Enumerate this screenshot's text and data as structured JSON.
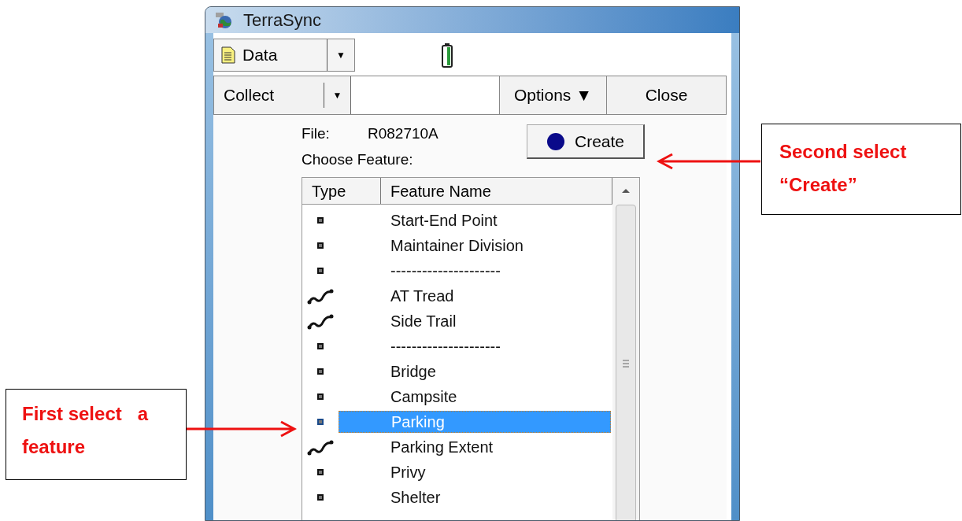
{
  "window": {
    "title": "TerraSync"
  },
  "toolbar": {
    "data_button": "Data",
    "dropdown_arrow": "▼"
  },
  "section_bar": {
    "collect_button": "Collect",
    "collect_arrow": "▼",
    "options_button": "Options ▼",
    "close_button": "Close"
  },
  "file": {
    "label": "File:",
    "value": "R082710A"
  },
  "choose_label": "Choose Feature:",
  "create_button": "Create",
  "table": {
    "columns": [
      "Type",
      "Feature Name"
    ],
    "rows": [
      {
        "kind": "point",
        "name": "Start-End Point",
        "selected": false
      },
      {
        "kind": "point",
        "name": "Maintainer Division",
        "selected": false
      },
      {
        "kind": "point",
        "name": "---------------------",
        "selected": false
      },
      {
        "kind": "line",
        "name": "AT Tread",
        "selected": false
      },
      {
        "kind": "line",
        "name": "Side Trail",
        "selected": false
      },
      {
        "kind": "point",
        "name": "---------------------",
        "selected": false
      },
      {
        "kind": "point",
        "name": "Bridge",
        "selected": false
      },
      {
        "kind": "point",
        "name": "Campsite",
        "selected": false
      },
      {
        "kind": "point",
        "name": "Parking",
        "selected": true
      },
      {
        "kind": "line",
        "name": "Parking Extent",
        "selected": false
      },
      {
        "kind": "point",
        "name": "Privy",
        "selected": false
      },
      {
        "kind": "point",
        "name": "Shelter",
        "selected": false
      }
    ]
  },
  "callouts": [
    {
      "text": "Second select “Create”",
      "kind": "right"
    },
    {
      "text": "First select   a feature",
      "kind": "left"
    }
  ]
}
